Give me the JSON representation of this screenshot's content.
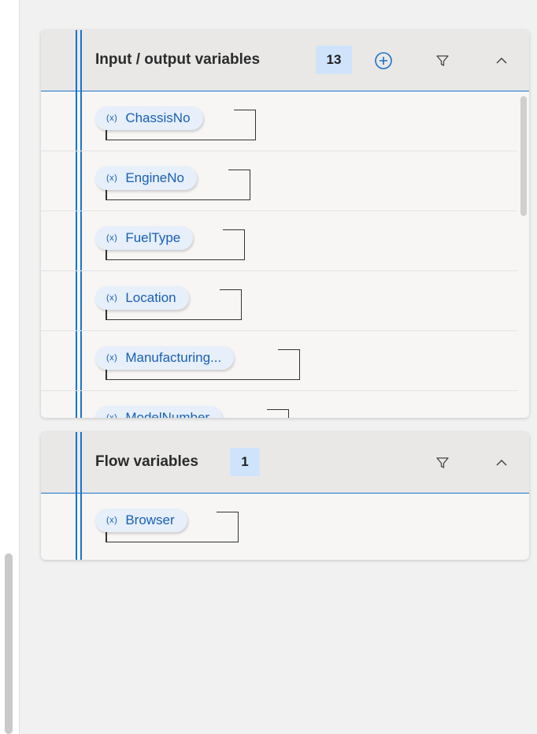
{
  "io_panel": {
    "title": "Input / output variables",
    "count": "13",
    "icons": [
      "add-circle-icon",
      "filter-icon",
      "chevron-up-icon"
    ],
    "variables": [
      {
        "label": "ChassisNo",
        "icon": "(x)"
      },
      {
        "label": "EngineNo",
        "icon": "(x)"
      },
      {
        "label": "FuelType",
        "icon": "(x)"
      },
      {
        "label": "Location",
        "icon": "(x)"
      },
      {
        "label": "Manufacturing...",
        "icon": "(x)"
      },
      {
        "label": "ModelNumber",
        "icon": "(x)"
      }
    ]
  },
  "flow_panel": {
    "title": "Flow variables",
    "count": "1",
    "icons": [
      "filter-icon",
      "chevron-up-icon"
    ],
    "variables": [
      {
        "label": "Browser",
        "icon": "(x)"
      }
    ]
  },
  "colors": {
    "accent": "#1a73c9",
    "chip_text": "#1a5fb4",
    "chip_bg": "#e6effa",
    "badge_bg": "#cfe4fb"
  }
}
